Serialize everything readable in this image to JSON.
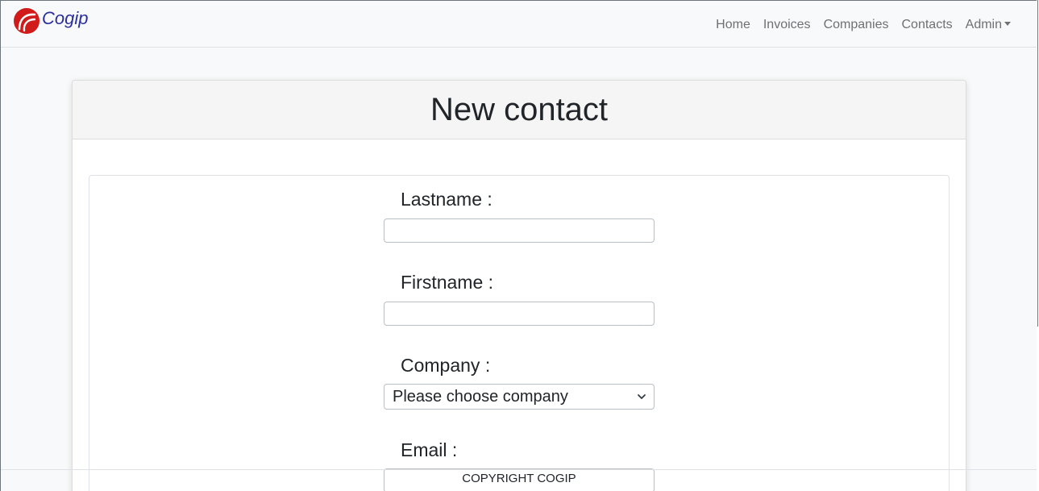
{
  "navbar": {
    "brand": "Cogip",
    "links": [
      "Home",
      "Invoices",
      "Companies",
      "Contacts",
      "Admin"
    ]
  },
  "page": {
    "title": "New contact"
  },
  "form": {
    "lastname_label": "Lastname :",
    "lastname_value": "",
    "firstname_label": "Firstname :",
    "firstname_value": "",
    "company_label": "Company :",
    "company_selected": "Please choose company",
    "email_label": "Email :",
    "email_value": ""
  },
  "footer": {
    "text": "COPYRIGHT COGIP"
  },
  "colors": {
    "brand_red": "#d11a1a",
    "brand_text": "#2b2f9e",
    "nav_text": "#6d7175"
  }
}
